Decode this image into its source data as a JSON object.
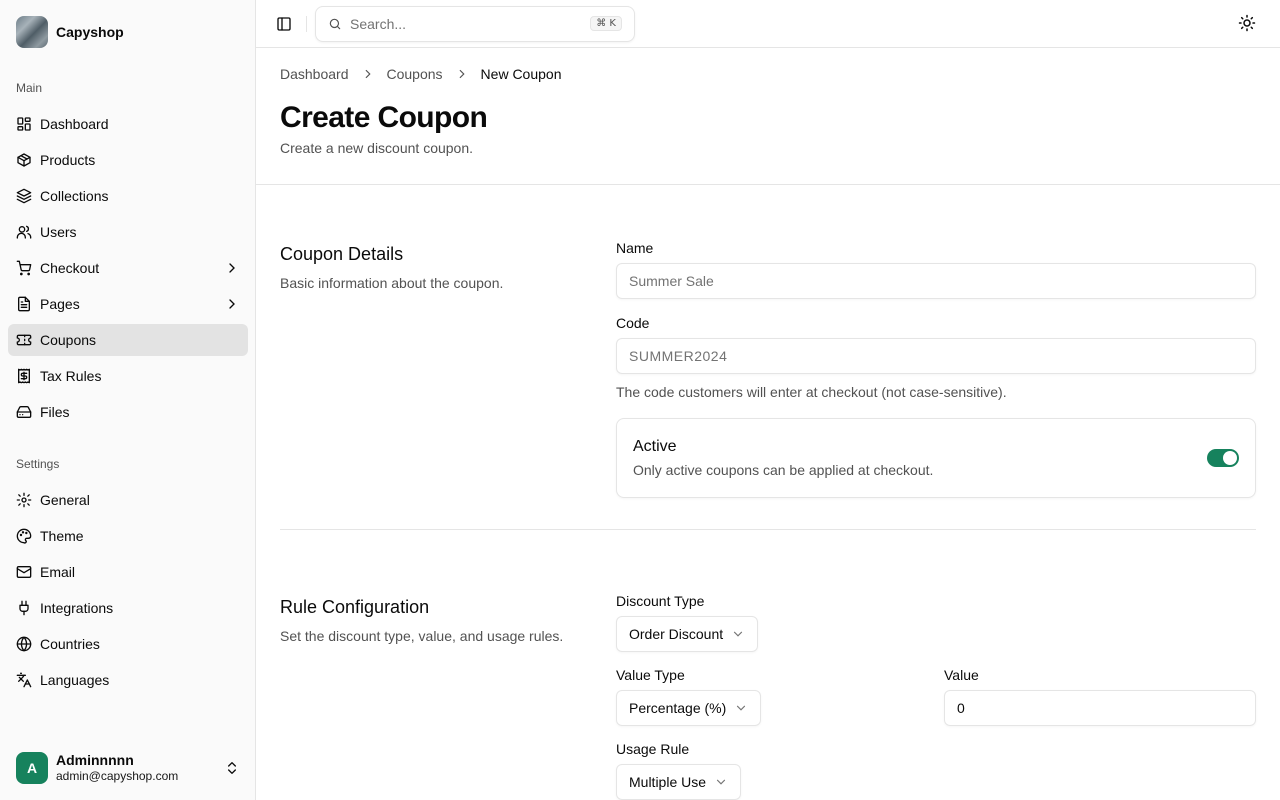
{
  "brand": {
    "name": "Capyshop"
  },
  "sidebar": {
    "main_label": "Main",
    "main_items": [
      {
        "label": "Dashboard",
        "icon": "dashboard-icon"
      },
      {
        "label": "Products",
        "icon": "package-icon"
      },
      {
        "label": "Collections",
        "icon": "layers-icon"
      },
      {
        "label": "Users",
        "icon": "users-icon"
      },
      {
        "label": "Checkout",
        "icon": "cart-icon",
        "has_children": true
      },
      {
        "label": "Pages",
        "icon": "file-icon",
        "has_children": true
      },
      {
        "label": "Coupons",
        "icon": "ticket-icon",
        "active": true
      },
      {
        "label": "Tax Rules",
        "icon": "receipt-icon"
      },
      {
        "label": "Files",
        "icon": "drive-icon"
      }
    ],
    "settings_label": "Settings",
    "settings_items": [
      {
        "label": "General",
        "icon": "gear-icon"
      },
      {
        "label": "Theme",
        "icon": "palette-icon"
      },
      {
        "label": "Email",
        "icon": "mail-icon"
      },
      {
        "label": "Integrations",
        "icon": "plug-icon"
      },
      {
        "label": "Countries",
        "icon": "globe-icon"
      },
      {
        "label": "Languages",
        "icon": "languages-icon"
      }
    ]
  },
  "user": {
    "initial": "A",
    "name": "Adminnnnn",
    "email": "admin@capyshop.com"
  },
  "topbar": {
    "search_placeholder": "Search...",
    "shortcut": "⌘ K"
  },
  "breadcrumb": {
    "items": [
      "Dashboard",
      "Coupons"
    ],
    "current": "New Coupon"
  },
  "page": {
    "title": "Create Coupon",
    "subtitle": "Create a new discount coupon."
  },
  "details": {
    "title": "Coupon Details",
    "description": "Basic information about the coupon.",
    "name_label": "Name",
    "name_placeholder": "Summer Sale",
    "code_label": "Code",
    "code_placeholder": "SUMMER2024",
    "code_help": "The code customers will enter at checkout (not case-sensitive).",
    "active_title": "Active",
    "active_desc": "Only active coupons can be applied at checkout.",
    "active_on": true
  },
  "rules": {
    "title": "Rule Configuration",
    "description": "Set the discount type, value, and usage rules.",
    "discount_type_label": "Discount Type",
    "discount_type_value": "Order Discount",
    "value_type_label": "Value Type",
    "value_type_value": "Percentage (%)",
    "value_label": "Value",
    "value_value": "0",
    "usage_rule_label": "Usage Rule",
    "usage_rule_value": "Multiple Use"
  },
  "colors": {
    "accent": "#16825d",
    "active_nav_bg": "#e3e3e3"
  }
}
